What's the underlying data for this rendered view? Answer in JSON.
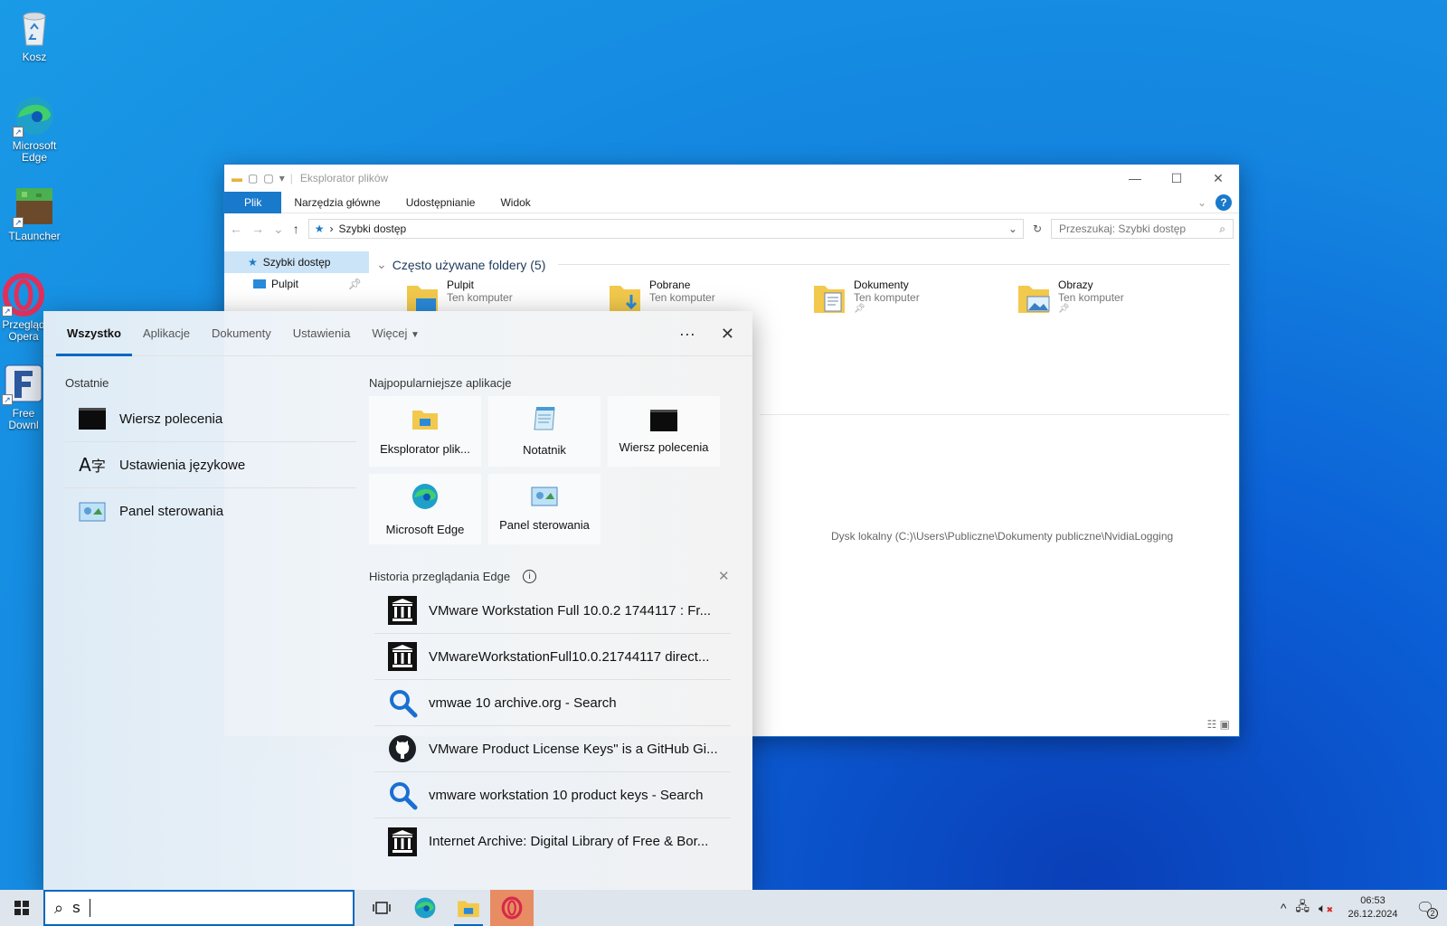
{
  "desktop": {
    "icons": [
      {
        "label": "Kosz",
        "icon": "recycle-bin-icon"
      },
      {
        "label": "Microsoft Edge",
        "icon": "edge-icon"
      },
      {
        "label": "TLauncher",
        "icon": "tlauncher-icon"
      },
      {
        "label": "Przegląd Opera",
        "icon": "opera-icon"
      },
      {
        "label": "Free Downl",
        "icon": "free-download-icon"
      }
    ]
  },
  "explorer": {
    "title": "Eksplorator plików",
    "ribbon_tabs": [
      "Plik",
      "Narzędzia główne",
      "Udostępnianie",
      "Widok"
    ],
    "address": "Szybki dostęp",
    "search_placeholder": "Przeszukaj: Szybki dostęp",
    "nav": [
      "Szybki dostęp",
      "Pulpit"
    ],
    "group_header": "Często używane foldery (5)",
    "folders": [
      {
        "name": "Pulpit",
        "sub": "Ten komputer"
      },
      {
        "name": "Pobrane",
        "sub": "Ten komputer"
      },
      {
        "name": "Dokumenty",
        "sub": "Ten komputer"
      },
      {
        "name": "Obrazy",
        "sub": "Ten komputer"
      }
    ],
    "recent_path": "Dysk lokalny (C:)\\Users\\Publiczne\\Dokumenty publiczne\\NvidiaLogging"
  },
  "search_panel": {
    "tabs": [
      "Wszystko",
      "Aplikacje",
      "Dokumenty",
      "Ustawienia",
      "Więcej"
    ],
    "more_glyph": "···",
    "close_glyph": "✕",
    "recent_header": "Ostatnie",
    "recent": [
      {
        "label": "Wiersz polecenia",
        "icon": "cmd-icon"
      },
      {
        "label": "Ustawienia językowe",
        "icon": "language-settings-icon"
      },
      {
        "label": "Panel sterowania",
        "icon": "control-panel-icon"
      }
    ],
    "top_apps_header": "Najpopularniejsze aplikacje",
    "top_apps": [
      {
        "label": "Eksplorator plik...",
        "icon": "file-explorer-icon"
      },
      {
        "label": "Notatnik",
        "icon": "notepad-icon"
      },
      {
        "label": "Wiersz polecenia",
        "icon": "cmd-icon"
      },
      {
        "label": "Microsoft Edge",
        "icon": "edge-icon"
      },
      {
        "label": "Panel sterowania",
        "icon": "control-panel-icon"
      }
    ],
    "history_header": "Historia przeglądania Edge",
    "history": [
      {
        "label": "VMware Workstation Full 10.0.2 1744117 : Fr...",
        "icon": "archive-icon"
      },
      {
        "label": "VMwareWorkstationFull10.0.21744117 direct...",
        "icon": "archive-icon"
      },
      {
        "label": "vmwae 10 archive.org - Search",
        "icon": "search-icon"
      },
      {
        "label": "VMware Product License Keys\" is a GitHub Gi...",
        "icon": "github-icon"
      },
      {
        "label": "vmware workstation 10 product keys - Search",
        "icon": "search-icon"
      },
      {
        "label": "Internet Archive: Digital Library of Free & Bor...",
        "icon": "archive-icon"
      }
    ]
  },
  "taskbar": {
    "search_value": "s",
    "time": "06:53",
    "date": "26.12.2024",
    "notification_count": "2"
  }
}
